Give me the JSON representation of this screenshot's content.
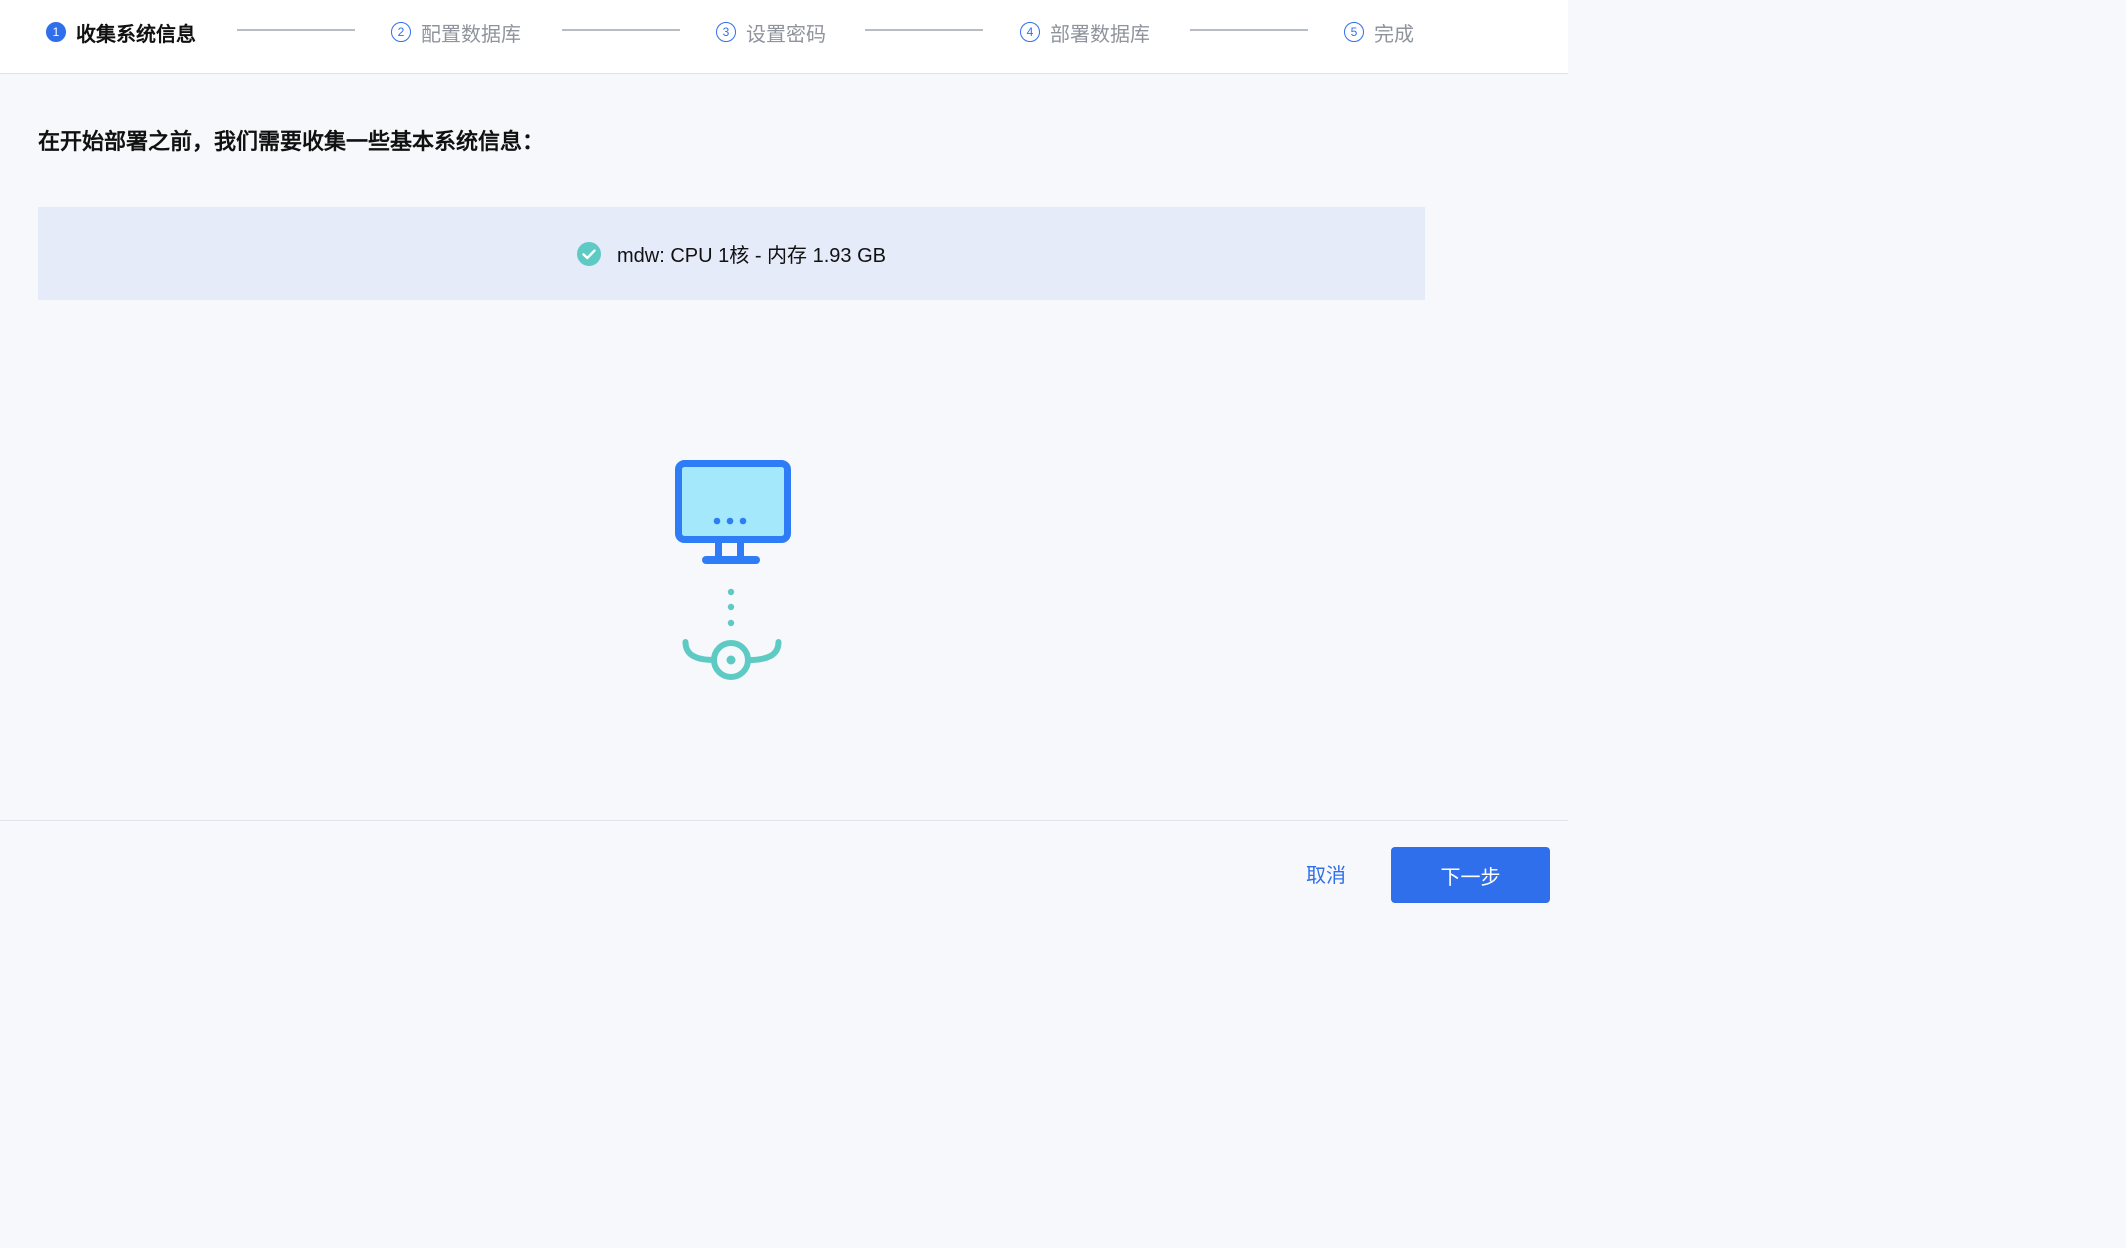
{
  "stepper": {
    "steps": [
      {
        "number": "1",
        "label": "收集系统信息",
        "state": "active"
      },
      {
        "number": "2",
        "label": "配置数据库",
        "state": "pending"
      },
      {
        "number": "3",
        "label": "设置密码",
        "state": "pending"
      },
      {
        "number": "4",
        "label": "部署数据库",
        "state": "pending"
      },
      {
        "number": "5",
        "label": "完成",
        "state": "pending"
      }
    ]
  },
  "main": {
    "headline": "在开始部署之前，我们需要收集一些基本系统信息：",
    "system_info": {
      "text": "mdw: CPU 1核 - 内存 1.93 GB",
      "status_icon": "check-circle-icon",
      "status_color": "#5ecac4"
    },
    "illustration": {
      "icons": [
        "computer-monitor-icon",
        "network-node-icon"
      ],
      "monitor_color": "#2f7df6",
      "screen_color": "#a3e8fb",
      "node_color": "#5ecac4"
    }
  },
  "footer": {
    "cancel_label": "取消",
    "next_label": "下一步"
  },
  "colors": {
    "accent": "#2f6fec",
    "banner_background": "#e6ebfa",
    "page_background": "#f7f8fc"
  }
}
